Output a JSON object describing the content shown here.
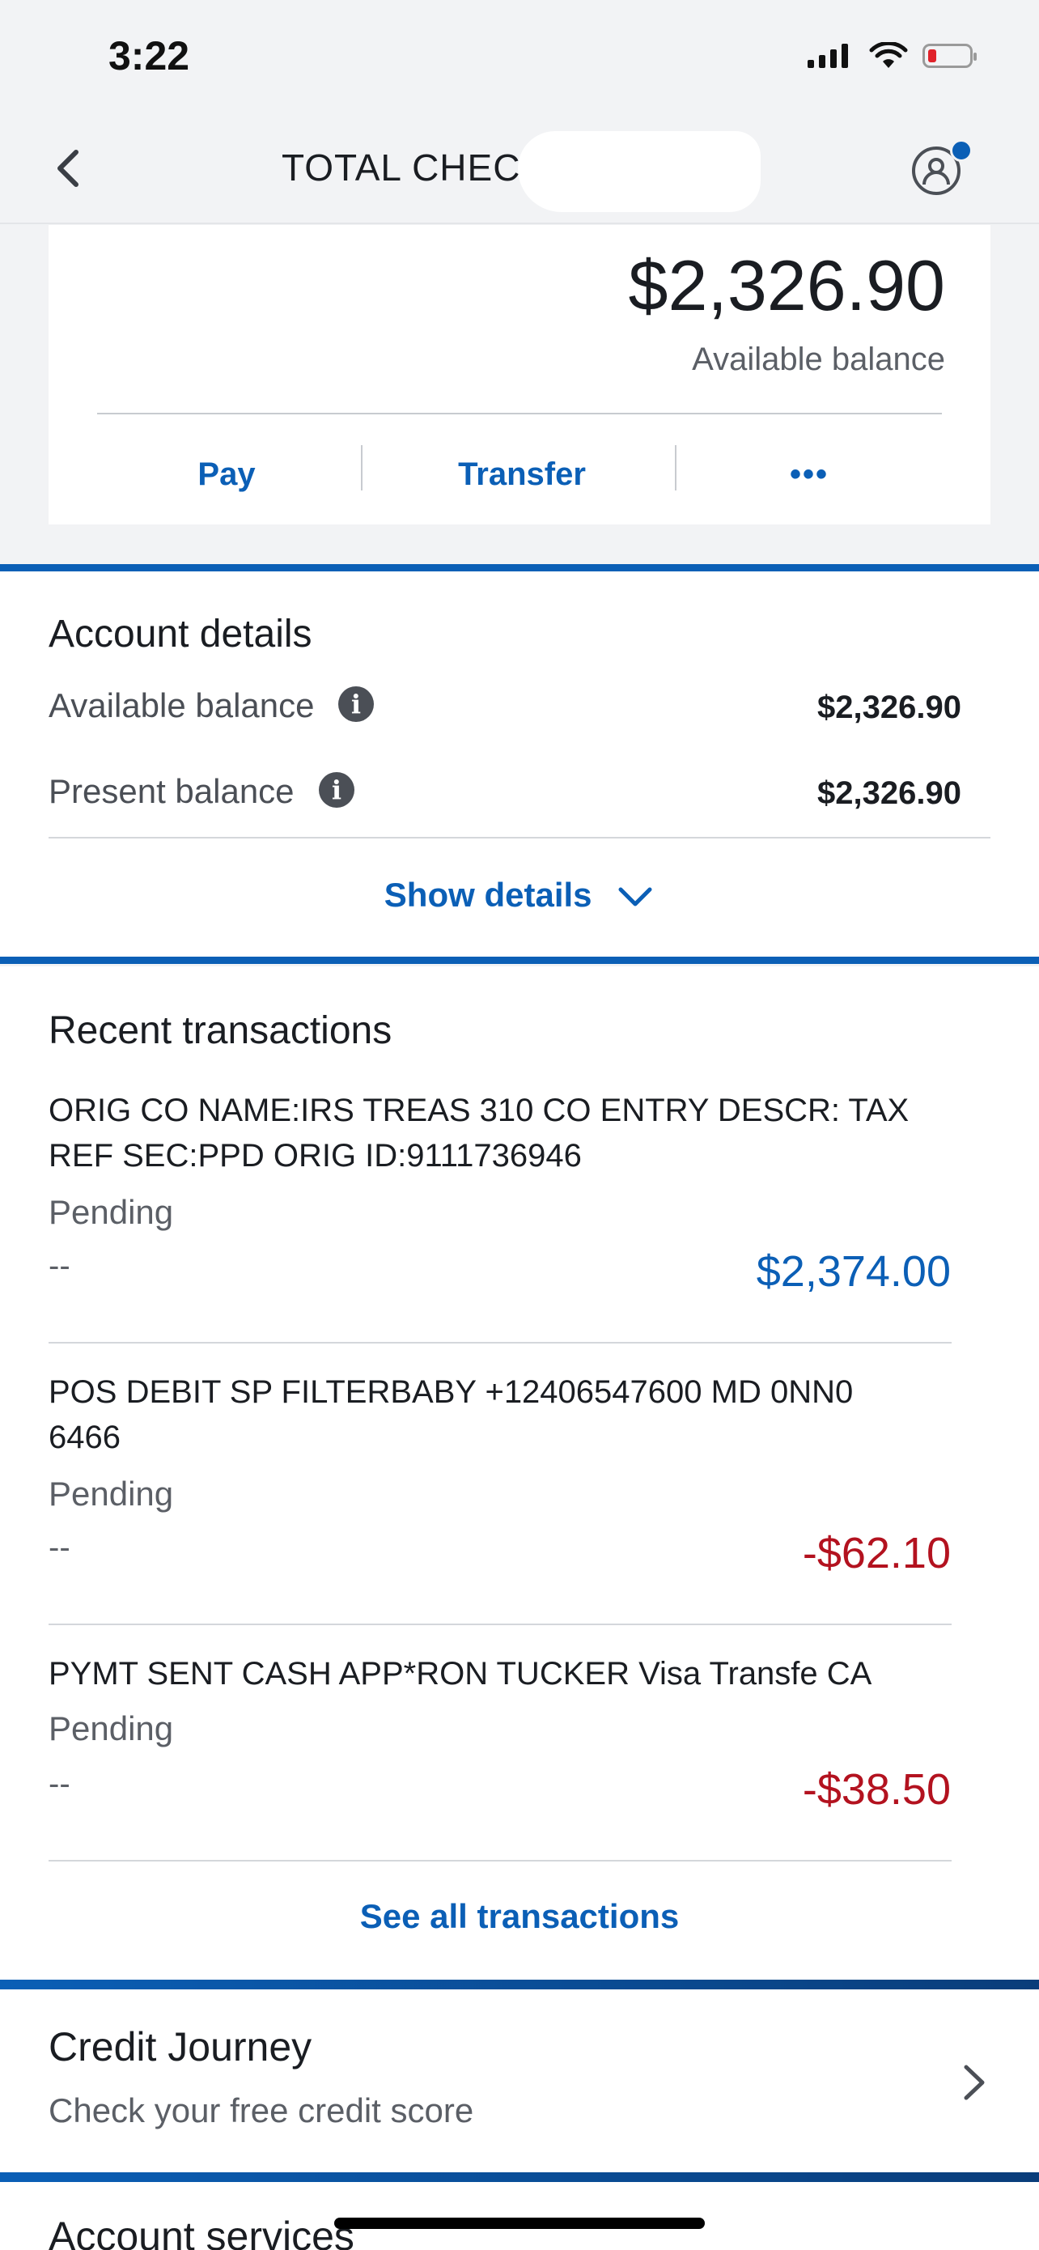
{
  "status_bar": {
    "time": "3:22"
  },
  "header": {
    "title": "TOTAL CHECK"
  },
  "balance_card": {
    "amount": "$2,326.90",
    "label": "Available balance",
    "actions": {
      "pay": "Pay",
      "transfer": "Transfer",
      "more": "•••"
    }
  },
  "account_details": {
    "title": "Account details",
    "rows": [
      {
        "label": "Available balance",
        "value": "$2,326.90"
      },
      {
        "label": "Present balance",
        "value": "$2,326.90"
      }
    ],
    "show_details": "Show details"
  },
  "recent_transactions": {
    "title": "Recent transactions",
    "items": [
      {
        "description": "ORIG CO NAME:IRS TREAS 310 CO ENTRY DESCR: TAX REF SEC:PPD ORIG ID:9111736946",
        "status": "Pending",
        "date": "--",
        "amount": "$2,374.00"
      },
      {
        "description": "POS DEBIT SP FILTERBABY +12406547600 MD 0NN0 6466",
        "status": "Pending",
        "date": "--",
        "amount": "-$62.10"
      },
      {
        "description": "PYMT SENT CASH APP*RON TUCKER Visa Transfe CA",
        "status": "Pending",
        "date": "--",
        "amount": "-$38.50"
      }
    ],
    "see_all": "See all transactions"
  },
  "credit_journey": {
    "title": "Credit Journey",
    "subtitle": "Check your free credit score"
  },
  "account_services": {
    "title": "Account services"
  },
  "colors": {
    "accent": "#0b5fb6",
    "negative": "#b3121f"
  }
}
